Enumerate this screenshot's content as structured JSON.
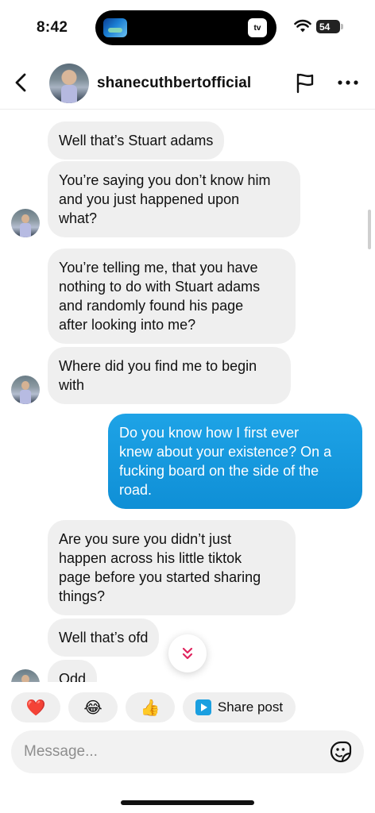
{
  "status": {
    "time": "8:42",
    "battery": "54",
    "island_tv": "tv"
  },
  "header": {
    "username": "shanecuthbertofficial"
  },
  "messages": [
    {
      "text": "Well that’s Stuart adams"
    },
    {
      "text": "You’re saying you don’t know him\nand you just happened upon\nwhat?"
    },
    {
      "text": "You’re telling me, that you have\nnothing to do with Stuart adams\nand randomly found his page\nafter looking into me?"
    },
    {
      "text": "Where did you find me to begin\nwith"
    },
    {
      "text": "Do you know how I first ever\nknew about your existence? On a\nfucking board on the side of the\nroad."
    },
    {
      "text": "Are you sure you didn’t just\nhappen across his little tiktok\npage before you started sharing\nthings?"
    },
    {
      "text": "Well that’s ofd"
    },
    {
      "text": "Odd"
    }
  ],
  "quick_replies": {
    "heart": "❤️",
    "laugh": "😂",
    "thumbs": "👍",
    "share_label": "Share post"
  },
  "composer": {
    "placeholder": "Message..."
  },
  "colors": {
    "outgoing_bubble": "#1a9fe0",
    "incoming_bubble": "#efefef"
  }
}
